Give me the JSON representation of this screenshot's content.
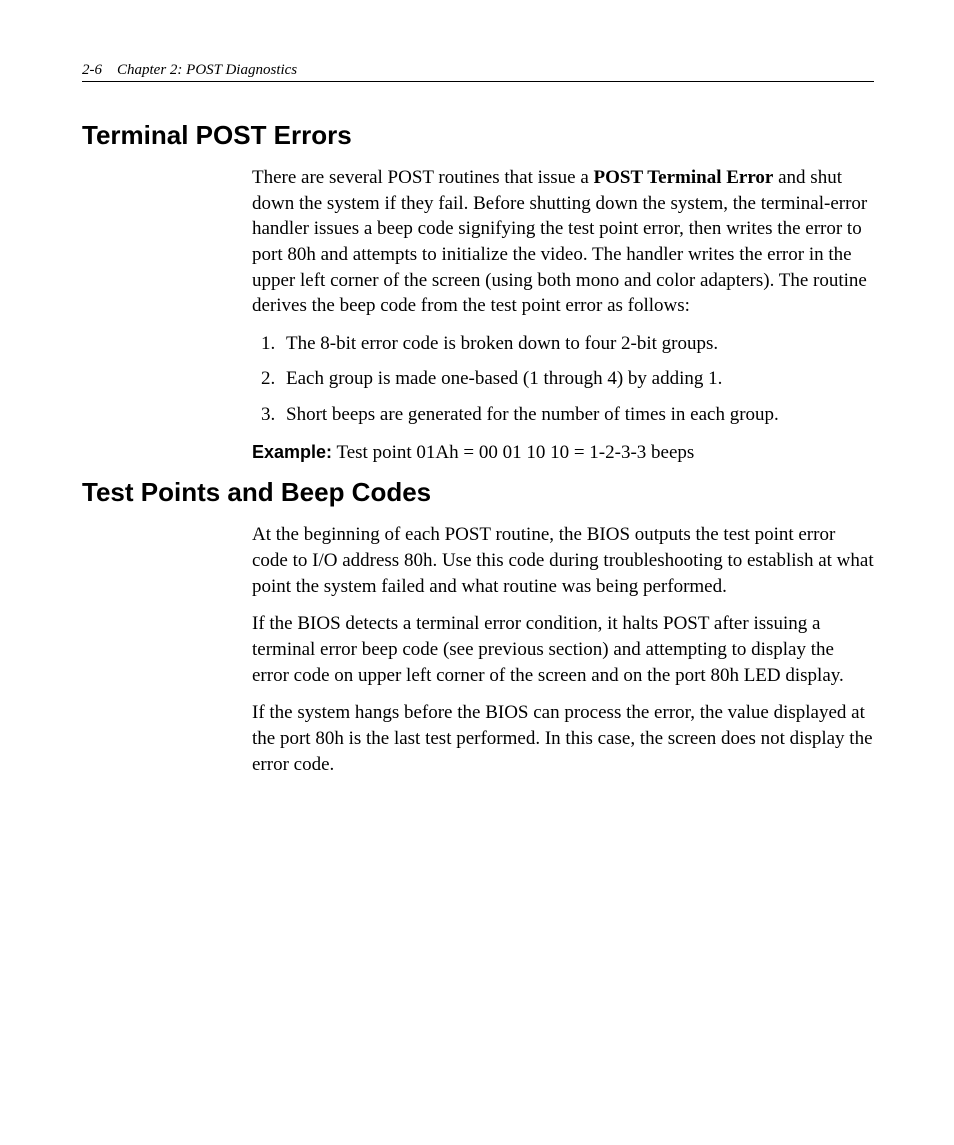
{
  "header": {
    "page_number": "2-6",
    "chapter_label": "Chapter 2:  POST Diagnostics"
  },
  "section1": {
    "heading": "Terminal POST Errors",
    "para1_a": "There are several POST routines that issue a ",
    "para1_bold": "POST Terminal Error",
    "para1_b": " and shut down the system if they fail. Before shutting down the system, the terminal-error handler issues a beep code signifying the test point error, then writes the error to port 80h and attempts to initialize the video. The handler writes the error in the upper left corner of the screen (using both mono and color adapters). The routine derives the beep code from the test point error as follows:",
    "list": [
      "The 8-bit error code is broken down to four 2-bit groups.",
      "Each group is made one-based (1 through 4) by adding 1.",
      "Short beeps are generated for the number of times in each group."
    ],
    "example_label": "Example:",
    "example_text": "  Test point 01Ah = 00 01 10 10 = 1-2-3-3 beeps"
  },
  "section2": {
    "heading": "Test Points and Beep Codes",
    "para1": "At the beginning of each POST routine, the BIOS outputs the test point error code to I/O address 80h. Use this code during troubleshooting to establish at what point the system failed and what routine was being performed.",
    "para2": "If the BIOS detects a terminal error condition, it halts POST after issuing a terminal error beep code (see previous section) and attempting to display the error code on upper left corner of the screen and on the port 80h LED display.",
    "para3": "If the system hangs before the BIOS can process the error, the value displayed at the port 80h is the last test performed. In this case, the screen does not display the error code."
  }
}
